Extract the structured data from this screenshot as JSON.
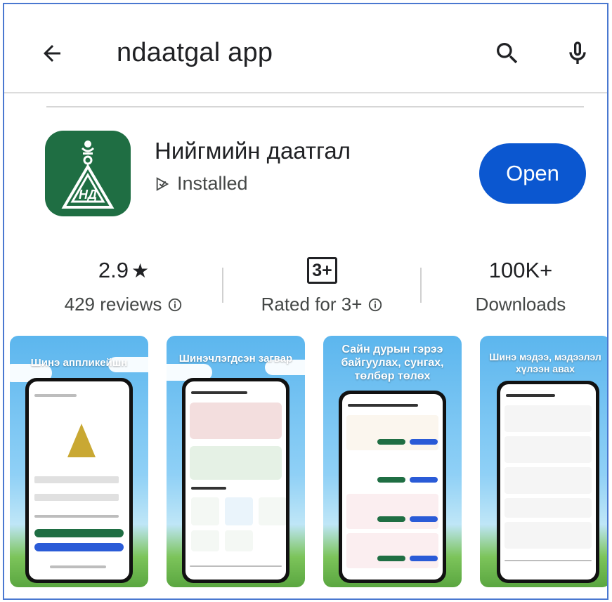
{
  "search": {
    "query": "ndaatgal app"
  },
  "app": {
    "name": "Нийгмийн даатгал",
    "status": "Installed",
    "open_label": "Open",
    "icon_color": "#1f6e43"
  },
  "stats": {
    "rating": {
      "value": "2.9",
      "star": "★",
      "label": "429 reviews"
    },
    "content_rating": {
      "badge": "3+",
      "label": "Rated for 3+"
    },
    "downloads": {
      "value": "100K+",
      "label": "Downloads"
    }
  },
  "screenshots": [
    {
      "caption": "Шинэ аппликейшн"
    },
    {
      "caption": "Шинэчлэгдсэн загвар"
    },
    {
      "caption": "Сайн дурын гэрээ байгуулах, сунгах, төлбөр төлөх"
    },
    {
      "caption": "Шинэ мэдээ, мэдээлэл хүлээн авах"
    }
  ],
  "colors": {
    "accent": "#0b57d0",
    "border": "#4a78d0"
  }
}
